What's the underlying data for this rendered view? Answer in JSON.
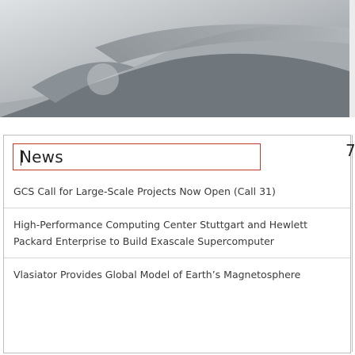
{
  "news": {
    "heading": "News",
    "items": [
      "GCS Call for Large-Scale Projects Now Open (Call 31)",
      "High-Performance Computing Center Stuttgart and Hewlett Packard Enterprise to Build Exascale Supercomputer",
      "Vlasiator Provides Global Model of Earth’s Magnetosphere"
    ]
  },
  "edge_glyph": "7"
}
